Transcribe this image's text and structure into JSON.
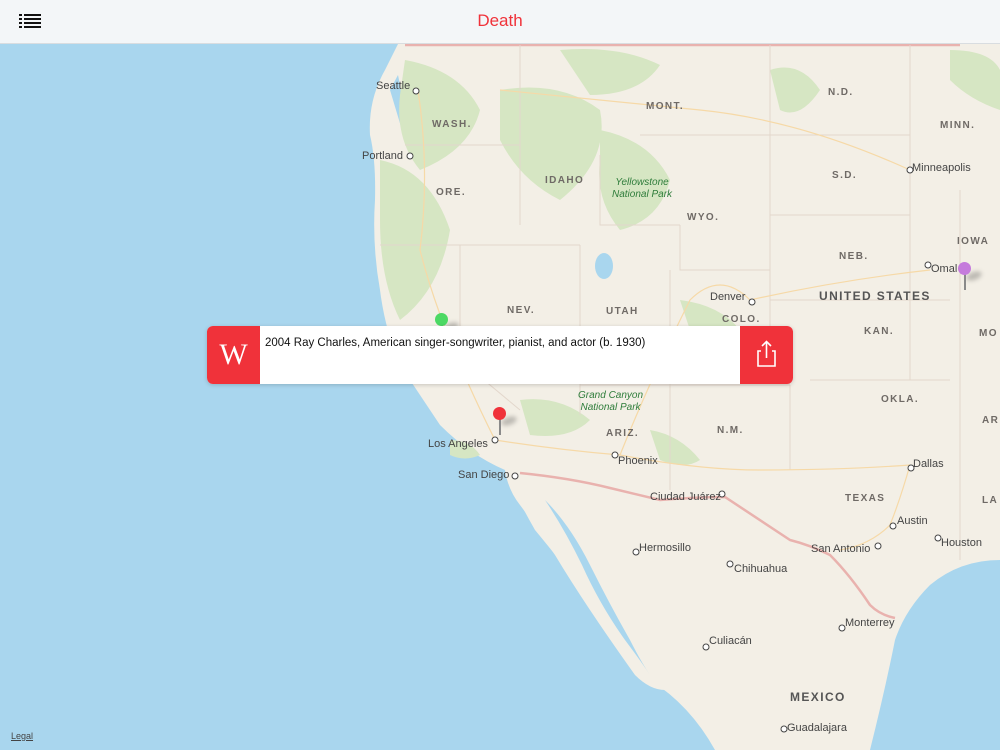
{
  "header": {
    "title": "Death",
    "menu_icon": "list-icon"
  },
  "callout": {
    "wiki_icon": "wikipedia-icon",
    "wiki_letter": "W",
    "text": "2004 Ray Charles, American singer-songwriter, pianist, and actor (b. 1930)",
    "share_icon": "share-icon"
  },
  "map": {
    "legal": "Legal",
    "country_labels": {
      "usa": "UNITED STATES",
      "mexico": "MEXICO"
    },
    "state_labels": {
      "wash": "WASH.",
      "ore": "ORE.",
      "idaho": "IDAHO",
      "mont": "MONT.",
      "wyo": "WYO.",
      "nd": "N.D.",
      "sd": "S.D.",
      "minn": "MINN.",
      "neb": "NEB.",
      "iowa": "IOWA",
      "nev": "NEV.",
      "utah": "UTAH",
      "colo": "COLO.",
      "kan": "KAN.",
      "mo": "MO",
      "ariz": "ARIZ.",
      "nm": "N.M.",
      "okla": "OKLA.",
      "texas": "TEXAS",
      "ark": "AR",
      "la": "LA"
    },
    "park_labels": {
      "yellowstone": "Yellowstone\nNational Park",
      "grand_canyon": "Grand Canyon\nNational Park"
    },
    "city_labels": {
      "seattle": "Seattle",
      "portland": "Portland",
      "minneapolis": "Minneapolis",
      "omaha": "Omal",
      "denver": "Denver",
      "los_angeles": "Los Angeles",
      "san_diego": "San Diego",
      "phoenix": "Phoenix",
      "ciudad_juarez": "Ciudad Juárez",
      "dallas": "Dallas",
      "austin": "Austin",
      "san_antonio": "San Antonio",
      "houston": "Houston",
      "hermosillo": "Hermosillo",
      "chihuahua": "Chihuahua",
      "monterrey": "Monterrey",
      "culiacan": "Culiacán",
      "guadalajara": "Guadalajara"
    },
    "pins": [
      {
        "name": "green-pin",
        "color": "#4cd964"
      },
      {
        "name": "red-pin",
        "color": "#f0323a"
      },
      {
        "name": "purple-pin",
        "color": "#c57bdc"
      }
    ]
  },
  "colors": {
    "accent": "#f0323a",
    "water": "#a9d6ee",
    "land": "#f3efe6",
    "forest": "#d6e6c3"
  }
}
